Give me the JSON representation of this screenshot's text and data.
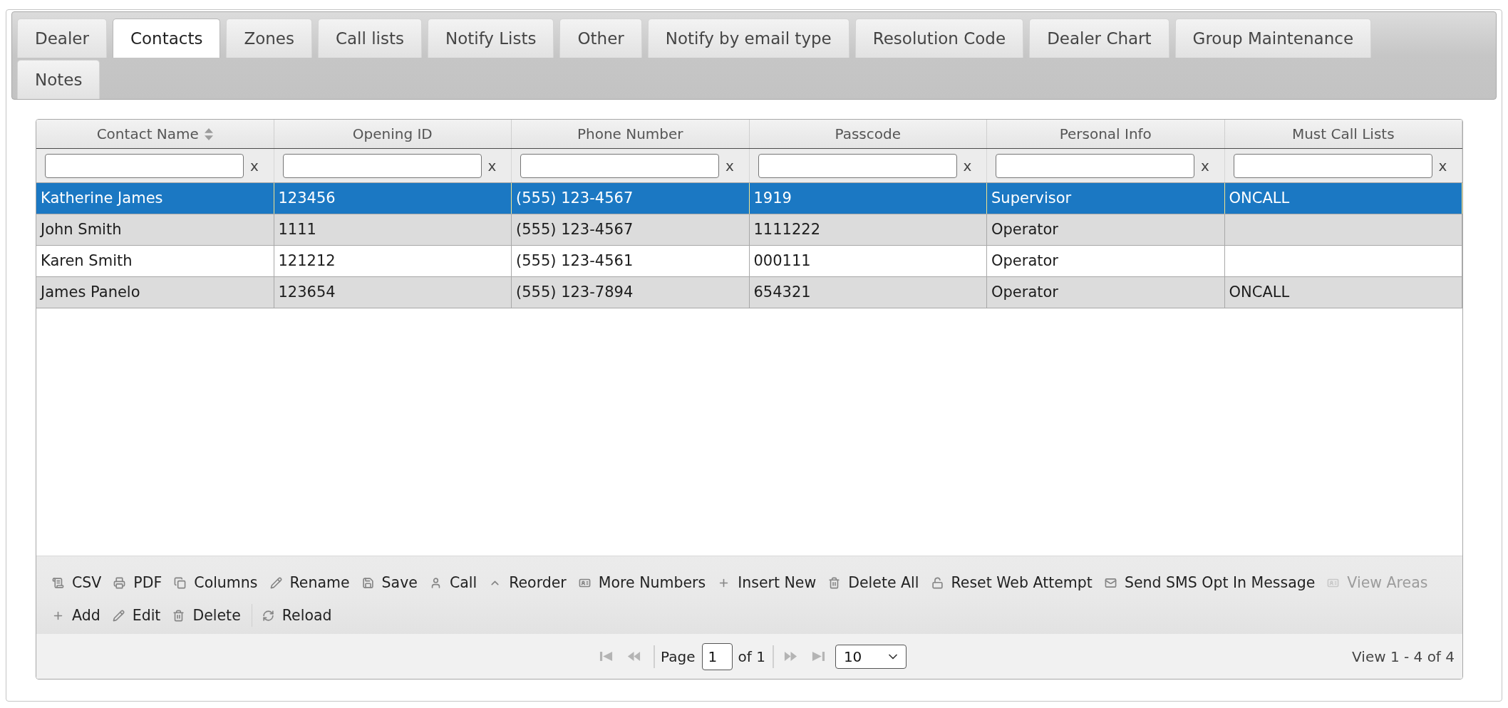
{
  "tabs": [
    {
      "label": "Dealer",
      "selected": false
    },
    {
      "label": "Contacts",
      "selected": true
    },
    {
      "label": "Zones",
      "selected": false
    },
    {
      "label": "Call lists",
      "selected": false
    },
    {
      "label": "Notify Lists",
      "selected": false
    },
    {
      "label": "Other",
      "selected": false
    },
    {
      "label": "Notify by email type",
      "selected": false
    },
    {
      "label": "Resolution Code",
      "selected": false
    },
    {
      "label": "Dealer Chart",
      "selected": false
    },
    {
      "label": "Group Maintenance",
      "selected": false
    },
    {
      "label": "Notes",
      "selected": false
    }
  ],
  "grid": {
    "columns": [
      {
        "label": "Contact Name",
        "sortable": true
      },
      {
        "label": "Opening ID",
        "sortable": false
      },
      {
        "label": "Phone Number",
        "sortable": false
      },
      {
        "label": "Passcode",
        "sortable": false
      },
      {
        "label": "Personal Info",
        "sortable": false
      },
      {
        "label": "Must Call Lists",
        "sortable": false
      }
    ],
    "filters": [
      {
        "clear": "x"
      },
      {
        "clear": "x"
      },
      {
        "clear": "x"
      },
      {
        "clear": "x"
      },
      {
        "clear": "x"
      },
      {
        "clear": "x"
      }
    ],
    "rows": [
      {
        "selected": true,
        "cells": [
          "Katherine James",
          "123456",
          "(555) 123-4567",
          "1919",
          "Supervisor",
          "ONCALL"
        ]
      },
      {
        "selected": false,
        "cells": [
          "John Smith",
          "1111",
          "(555) 123-4567",
          "1111222",
          "Operator"
        ]
      },
      {
        "selected": false,
        "cells": [
          "Karen Smith",
          "121212",
          "(555) 123-4561",
          "000111",
          "Operator"
        ]
      },
      {
        "selected": false,
        "cells": [
          "James Panelo",
          "123654",
          "(555) 123-7894",
          "654321",
          "Operator",
          "ONCALL"
        ]
      }
    ]
  },
  "toolbar": {
    "rows": [
      {
        "groups": [
          [
            {
              "label": "CSV",
              "disabled": false
            },
            {
              "label": "PDF",
              "disabled": false
            },
            {
              "label": "Columns",
              "disabled": false
            },
            {
              "label": "Rename",
              "disabled": false
            },
            {
              "label": "Save",
              "disabled": false
            },
            {
              "label": "Call",
              "disabled": false
            },
            {
              "label": "Reorder",
              "disabled": false
            },
            {
              "label": "More Numbers",
              "disabled": false
            },
            {
              "label": "Insert New",
              "disabled": false
            },
            {
              "label": "Delete All",
              "disabled": false
            },
            {
              "label": "Reset Web Attempt",
              "disabled": false
            },
            {
              "label": "Send SMS Opt In Message",
              "disabled": false
            },
            {
              "label": "View Areas",
              "disabled": true
            }
          ]
        ]
      },
      {
        "groups": [
          [
            {
              "label": "Add",
              "disabled": false
            },
            {
              "label": "Edit",
              "disabled": false
            },
            {
              "label": "Delete",
              "disabled": false
            }
          ],
          [
            {
              "label": "Reload",
              "disabled": false
            }
          ]
        ]
      }
    ]
  },
  "pager": {
    "nav_disabled": true,
    "page_label": "Page",
    "page": "1",
    "of_label": "of 1",
    "page_size": "10",
    "record_info": "View 1 - 4 of 4"
  }
}
